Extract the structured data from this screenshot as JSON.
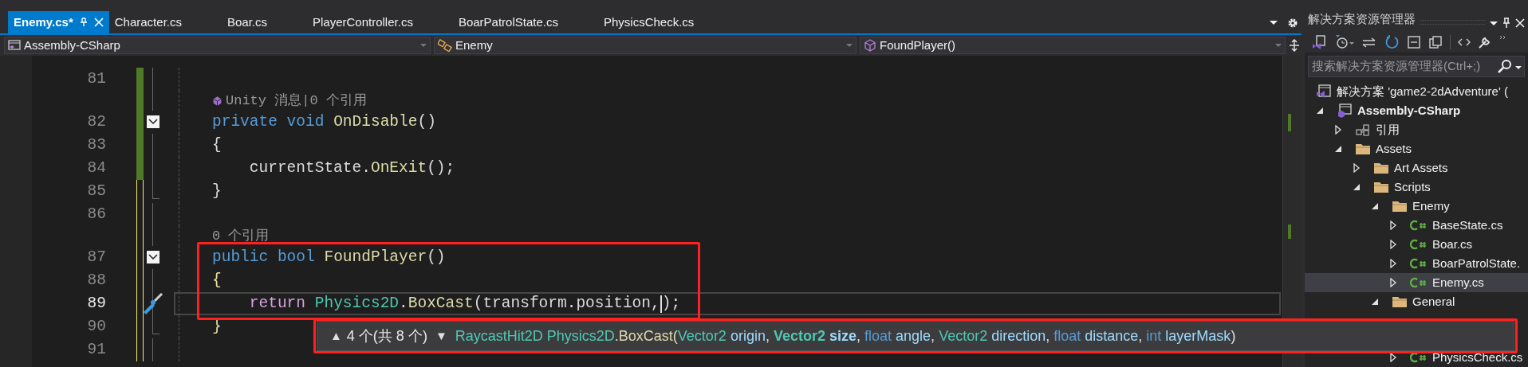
{
  "tabs": [
    {
      "label": "Enemy.cs*",
      "selected": true
    },
    {
      "label": "Character.cs",
      "selected": false
    },
    {
      "label": "Boar.cs",
      "selected": false
    },
    {
      "label": "PlayerController.cs",
      "selected": false
    },
    {
      "label": "BoarPatrolState.cs",
      "selected": false
    },
    {
      "label": "PhysicsCheck.cs",
      "selected": false
    }
  ],
  "navigation_bar": {
    "project": "Assembly-CSharp",
    "type": "Enemy",
    "member": "FoundPlayer()"
  },
  "editor": {
    "lines": [
      {
        "kind": "code",
        "number": "81",
        "saved": true,
        "fold_start": false,
        "fold_end": false,
        "current": false
      },
      {
        "kind": "unity_lens",
        "text": "Unity 消息|0 个引用",
        "saved": true
      },
      {
        "kind": "code",
        "number": "82",
        "saved": true,
        "fold_start": true,
        "fold_end": false,
        "current": false,
        "tokens": [
          {
            "kind": "keyword",
            "text": "private void "
          },
          {
            "kind": "method",
            "text": "OnDisable"
          },
          {
            "kind": "plain",
            "text": "()"
          }
        ]
      },
      {
        "kind": "code",
        "number": "83",
        "saved": true,
        "fold_start": false,
        "fold_end": false,
        "current": false,
        "tokens": [
          {
            "kind": "plain",
            "text": "{"
          }
        ]
      },
      {
        "kind": "code",
        "number": "84",
        "saved": true,
        "fold_start": false,
        "fold_end": false,
        "current": false,
        "tokens": [
          {
            "kind": "plain",
            "text": "    currentState."
          },
          {
            "kind": "method",
            "text": "OnExit"
          },
          {
            "kind": "plain",
            "text": "();"
          }
        ]
      },
      {
        "kind": "code",
        "number": "85",
        "saved": false,
        "fold_start": false,
        "fold_end": true,
        "current": false,
        "tokens": [
          {
            "kind": "plain",
            "text": "}"
          }
        ]
      },
      {
        "kind": "code",
        "number": "86",
        "saved": false,
        "fold_start": false,
        "fold_end": false,
        "current": false
      },
      {
        "kind": "lens",
        "text": "0 个引用",
        "saved": false
      },
      {
        "kind": "code",
        "number": "87",
        "saved": false,
        "fold_start": true,
        "fold_end": false,
        "current": false,
        "tokens": [
          {
            "kind": "keyword",
            "text": "public bool "
          },
          {
            "kind": "method",
            "text": "FoundPlayer"
          },
          {
            "kind": "plain",
            "text": "()"
          }
        ]
      },
      {
        "kind": "code",
        "number": "88",
        "saved": false,
        "fold_start": false,
        "fold_end": false,
        "current": false,
        "tokens": [
          {
            "kind": "brace",
            "text": "{"
          }
        ]
      },
      {
        "kind": "code",
        "number": "89",
        "saved": false,
        "fold_start": false,
        "fold_end": false,
        "current": true,
        "tokens": [
          {
            "kind": "control",
            "text": "    return "
          },
          {
            "kind": "type",
            "text": "Physics2D"
          },
          {
            "kind": "plain",
            "text": "."
          },
          {
            "kind": "method",
            "text": "BoxCast"
          },
          {
            "kind": "plain",
            "text": "(transform.position,"
          },
          {
            "kind": "caret"
          },
          {
            "kind": "plain",
            "text": ");"
          }
        ]
      },
      {
        "kind": "code",
        "number": "90",
        "saved": false,
        "fold_start": false,
        "fold_end": true,
        "current": false,
        "tokens": [
          {
            "kind": "brace",
            "text": "}"
          }
        ]
      },
      {
        "kind": "code",
        "number": "91",
        "saved": false,
        "fold_start": false,
        "fold_end": false,
        "current": false
      }
    ]
  },
  "signature_help": {
    "up_arrow": "▲",
    "counter": "4 个(共 8 个)",
    "down_arrow": "▼",
    "tokens": [
      {
        "kind": "type",
        "text": "RaycastHit2D ",
        "current": false
      },
      {
        "kind": "type",
        "text": "Physics2D",
        "current": false
      },
      {
        "kind": "plain",
        "text": ".",
        "current": false
      },
      {
        "kind": "method",
        "text": "BoxCast(",
        "current": false
      },
      {
        "kind": "type",
        "text": "Vector2 ",
        "current": false
      },
      {
        "kind": "param",
        "text": "origin",
        "current": false
      },
      {
        "kind": "plain",
        "text": ", ",
        "current": false
      },
      {
        "kind": "type",
        "text": "Vector2 ",
        "current": true
      },
      {
        "kind": "param",
        "text": "size",
        "current": true
      },
      {
        "kind": "plain",
        "text": ", ",
        "current": false
      },
      {
        "kind": "keyword",
        "text": "float ",
        "current": false
      },
      {
        "kind": "param",
        "text": "angle",
        "current": false
      },
      {
        "kind": "plain",
        "text": ", ",
        "current": false
      },
      {
        "kind": "type",
        "text": "Vector2 ",
        "current": false
      },
      {
        "kind": "param",
        "text": "direction",
        "current": false
      },
      {
        "kind": "plain",
        "text": ", ",
        "current": false
      },
      {
        "kind": "keyword",
        "text": "float ",
        "current": false
      },
      {
        "kind": "param",
        "text": "distance",
        "current": false
      },
      {
        "kind": "plain",
        "text": ", ",
        "current": false
      },
      {
        "kind": "keyword",
        "text": "int ",
        "current": false
      },
      {
        "kind": "param",
        "text": "layerMask",
        "current": false
      },
      {
        "kind": "plain",
        "text": ")",
        "current": false
      }
    ]
  },
  "solution_explorer": {
    "title": "解决方案资源管理器",
    "search": {
      "placeholder": "搜索解决方案资源管理器(Ctrl+;)"
    },
    "tree": [
      {
        "kind": "solution",
        "label": "解决方案 'game2-2dAdventure' (",
        "selected": false
      },
      {
        "kind": "project",
        "label": "Assembly-CSharp",
        "expanded": true,
        "selected": false,
        "children": [
          {
            "kind": "references",
            "label": "引用",
            "expanded": false,
            "selected": false
          },
          {
            "kind": "folder",
            "label": "Assets",
            "expanded": true,
            "selected": false,
            "children": [
              {
                "kind": "folder",
                "label": "Art Assets",
                "expanded": false,
                "selected": false
              },
              {
                "kind": "folder",
                "label": "Scripts",
                "expanded": true,
                "selected": false,
                "children": [
                  {
                    "kind": "folder",
                    "label": "Enemy",
                    "expanded": true,
                    "selected": false,
                    "children": [
                      {
                        "kind": "csharp",
                        "label": "BaseState.cs",
                        "expanded": false,
                        "selected": false
                      },
                      {
                        "kind": "csharp",
                        "label": "Boar.cs",
                        "expanded": false,
                        "selected": false
                      },
                      {
                        "kind": "csharp",
                        "label": "BoarPatrolState.",
                        "expanded": false,
                        "selected": false
                      },
                      {
                        "kind": "csharp",
                        "label": "Enemy.cs",
                        "expanded": false,
                        "selected": true
                      }
                    ]
                  },
                  {
                    "kind": "folder",
                    "label": "General",
                    "expanded": true,
                    "selected": false,
                    "children": [
                      {
                        "kind": "csharp",
                        "label": "PhysicsCheck.cs",
                        "expanded": false,
                        "selected": false
                      }
                    ]
                  }
                ]
              }
            ]
          }
        ]
      }
    ]
  },
  "annotations": {
    "code_box": true,
    "signature_box": true
  }
}
